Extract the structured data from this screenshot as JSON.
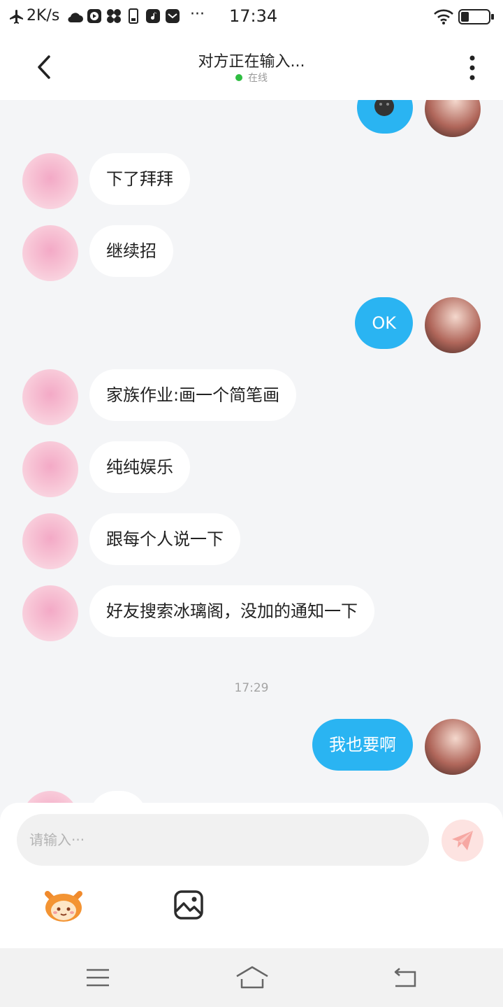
{
  "status_bar": {
    "network_speed": "2K/s",
    "more": "···",
    "time": "17:34"
  },
  "header": {
    "title": "对方正在输入...",
    "status": "在线"
  },
  "messages": [
    {
      "side": "in",
      "text": "下了拜拜"
    },
    {
      "side": "in",
      "text": "继续招"
    },
    {
      "side": "out",
      "text": "OK"
    },
    {
      "side": "in",
      "text": "家族作业:画一个简笔画"
    },
    {
      "side": "in",
      "text": "纯纯娱乐"
    },
    {
      "side": "in",
      "text": "跟每个人说一下"
    },
    {
      "side": "in",
      "text": "好友搜索冰璃阁，没加的通知一下"
    },
    {
      "side": "out",
      "text": "我也要啊"
    }
  ],
  "timestamp": "17:29",
  "composer": {
    "placeholder": "请输入···"
  },
  "colors": {
    "accent": "#2ab4f2",
    "online": "#2fbd42",
    "send_bg": "#fde3e1",
    "send_icon": "#f6a7a2"
  }
}
